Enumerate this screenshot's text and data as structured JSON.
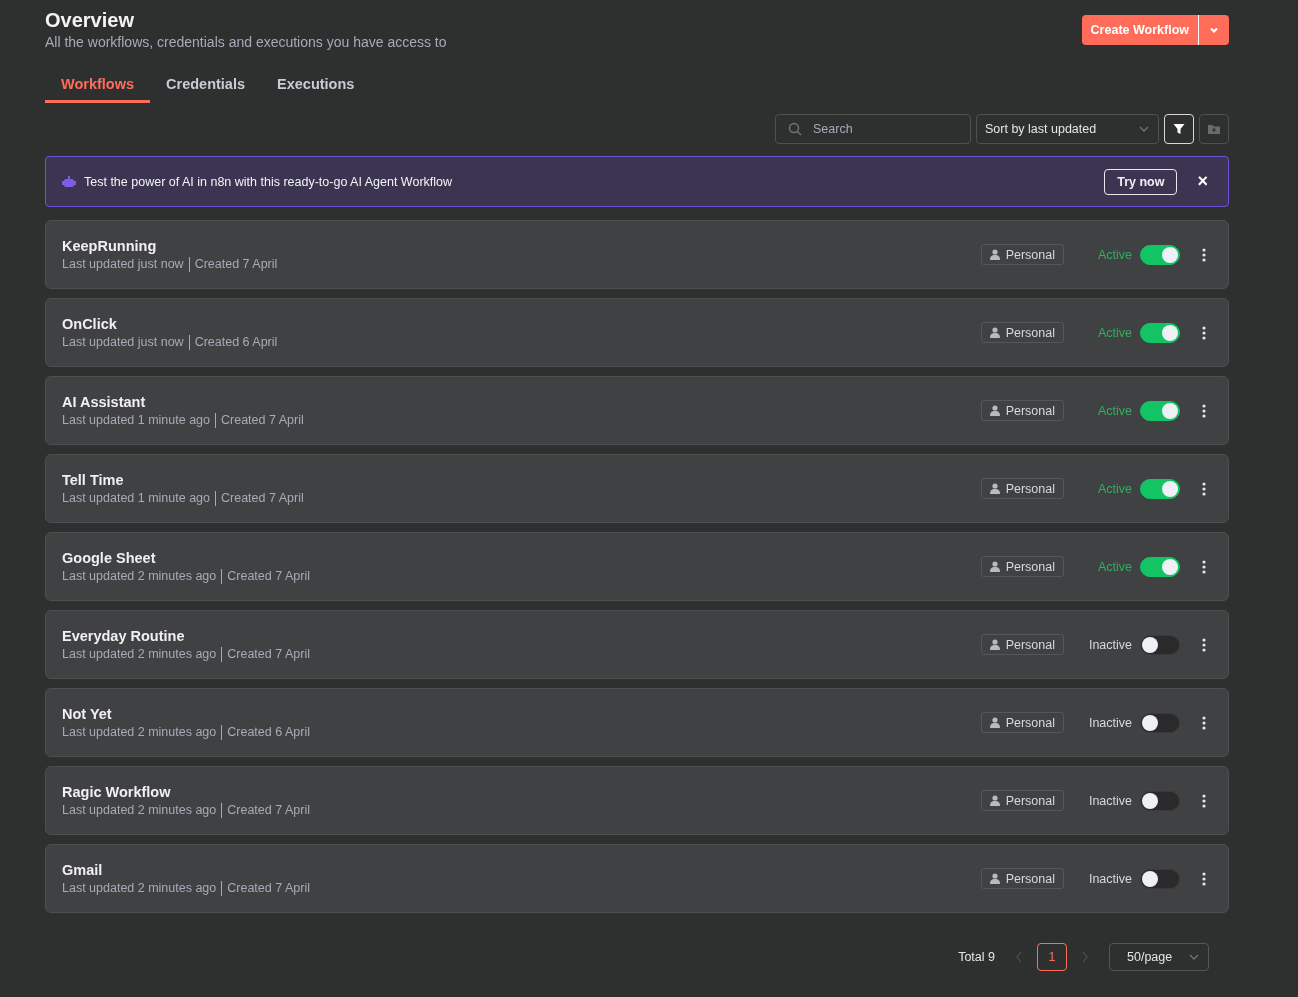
{
  "header": {
    "title": "Overview",
    "subtitle": "All the workflows, credentials and executions you have access to",
    "create_button": "Create Workflow"
  },
  "tabs": [
    {
      "label": "Workflows",
      "selected": true
    },
    {
      "label": "Credentials",
      "selected": false
    },
    {
      "label": "Executions",
      "selected": false
    }
  ],
  "toolbar": {
    "search": {
      "placeholder": "Search"
    },
    "sort": {
      "value": "Sort by last updated"
    },
    "filter_active": true
  },
  "banner": {
    "text": "Test the power of AI in n8n with this ready-to-go AI Agent Workflow",
    "button": "Try now",
    "close": "×"
  },
  "workflows": [
    {
      "name": "KeepRunning",
      "updated": "Last updated just now",
      "created": "Created 7 April",
      "owner": "Personal",
      "status": "Active",
      "on": true
    },
    {
      "name": "OnClick",
      "updated": "Last updated just now",
      "created": "Created 6 April",
      "owner": "Personal",
      "status": "Active",
      "on": true
    },
    {
      "name": "AI Assistant",
      "updated": "Last updated 1 minute ago",
      "created": "Created 7 April",
      "owner": "Personal",
      "status": "Active",
      "on": true
    },
    {
      "name": "Tell Time",
      "updated": "Last updated 1 minute ago",
      "created": "Created 7 April",
      "owner": "Personal",
      "status": "Active",
      "on": true
    },
    {
      "name": "Google Sheet",
      "updated": "Last updated 2 minutes ago",
      "created": "Created 7 April",
      "owner": "Personal",
      "status": "Active",
      "on": true
    },
    {
      "name": "Everyday Routine",
      "updated": "Last updated 2 minutes ago",
      "created": "Created 7 April",
      "owner": "Personal",
      "status": "Inactive",
      "on": false
    },
    {
      "name": "Not Yet",
      "updated": "Last updated 2 minutes ago",
      "created": "Created 6 April",
      "owner": "Personal",
      "status": "Inactive",
      "on": false
    },
    {
      "name": "Ragic Workflow",
      "updated": "Last updated 2 minutes ago",
      "created": "Created 7 April",
      "owner": "Personal",
      "status": "Inactive",
      "on": false
    },
    {
      "name": "Gmail",
      "updated": "Last updated 2 minutes ago",
      "created": "Created 7 April",
      "owner": "Personal",
      "status": "Inactive",
      "on": false
    }
  ],
  "pagination": {
    "total": "Total 9",
    "pages": [
      {
        "label": "1",
        "selected": true
      }
    ],
    "page_size": "50/page"
  }
}
